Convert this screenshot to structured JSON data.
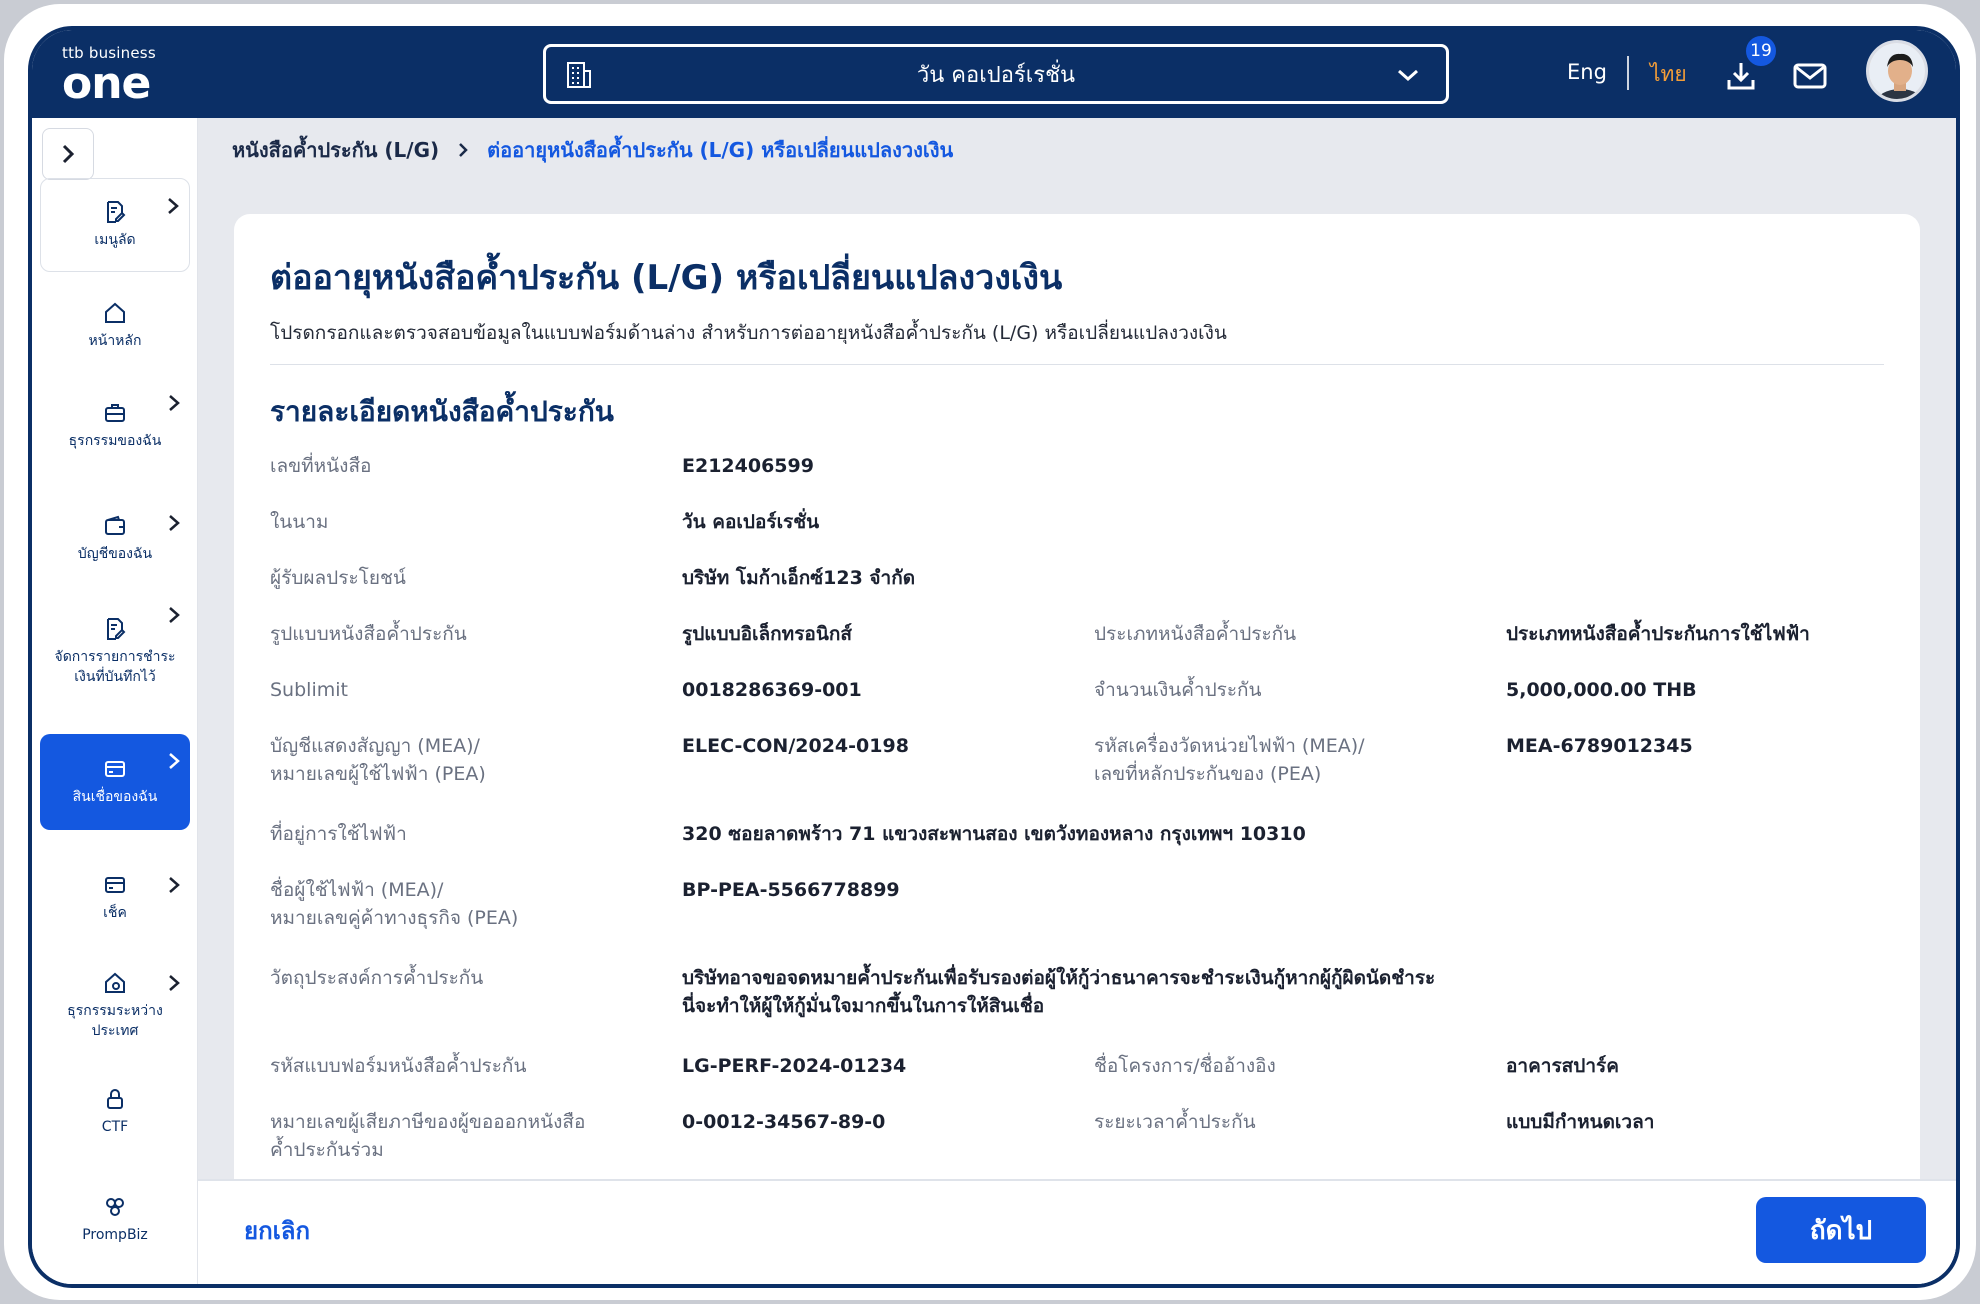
{
  "header": {
    "logo_small": "ttb business",
    "logo_big": "one",
    "company": "วัน คอเปอร์เรชั่น",
    "lang_eng": "Eng",
    "lang_th": "ไทย",
    "download_badge": "19",
    "icons": [
      "building-icon",
      "chevron-down-icon",
      "download-icon",
      "mail-icon"
    ]
  },
  "sidebar": {
    "items": [
      {
        "label": "เมนูลัด"
      },
      {
        "label": "หน้าหลัก"
      },
      {
        "label": "ธุรกรรมของฉัน"
      },
      {
        "label": "บัญชีของฉัน"
      },
      {
        "label": "จัดการรายการชำระเงินที่บันทึกไว้"
      },
      {
        "label": "สินเชื่อของฉัน"
      },
      {
        "label": "เช็ค"
      },
      {
        "label": "ธุรกรรมระหว่างประเทศ"
      },
      {
        "label": "CTF"
      },
      {
        "label": "PrompBiz"
      }
    ]
  },
  "breadcrumb": {
    "parent": "หนังสือค้ำประกัน (L/G)",
    "current": "ต่ออายุหนังสือค้ำประกัน (L/G) หรือเปลี่ยนแปลงวงเงิน"
  },
  "page": {
    "title": "ต่ออายุหนังสือค้ำประกัน (L/G) หรือเปลี่ยนแปลงวงเงิน",
    "subtitle": "โปรดกรอกและตรวจสอบข้อมูลในแบบฟอร์มด้านล่าง สำหรับการต่ออายุหนังสือค้ำประกัน (L/G) หรือเปลี่ยนแปลงวงเงิน",
    "section_title": "รายละเอียดหนังสือค้ำประกัน"
  },
  "details": {
    "doc_no_label": "เลขที่หนังสือ",
    "doc_no": "E212406599",
    "on_behalf_label": "ในนาม",
    "on_behalf": "วัน คอเปอร์เรชั่น",
    "beneficiary_label": "ผู้รับผลประโยชน์",
    "beneficiary": "บริษัท โมก้าเอ็กซ์123 จำกัด",
    "format_label": "รูปแบบหนังสือค้ำประกัน",
    "format": "รูปแบบอิเล็กทรอนิกส์",
    "type_label": "ประเภทหนังสือค้ำประกัน",
    "type": "ประเภทหนังสือค้ำประกันการใช้ไฟฟ้า",
    "sublimit_label": "Sublimit",
    "sublimit": "0018286369-001",
    "amount_label": "จำนวนเงินค้ำประกัน",
    "amount": "5,000,000.00 THB",
    "contract_label_1": "บัญชีแสดงสัญญา (MEA)/",
    "contract_label_2": "หมายเลขผู้ใช้ไฟฟ้า (PEA)",
    "contract": "ELEC-CON/2024-0198",
    "meter_label_1": "รหัสเครื่องวัดหน่วยไฟฟ้า (MEA)/",
    "meter_label_2": "เลขที่หลักประกันของ (PEA)",
    "meter": "MEA-6789012345",
    "address_label": "ที่อยู่การใช้ไฟฟ้า",
    "address": "320 ซอยลาดพร้าว 71 แขวงสะพานสอง เขตวังทองหลาง กรุงเทพฯ 10310",
    "user_label_1": "ชื่อผู้ใช้ไฟฟ้า (MEA)/",
    "user_label_2": "หมายเลขคู่ค้าทางธุรกิจ (PEA)",
    "user": "BP-PEA-5566778899",
    "purpose_label": "วัตถุประสงค์การค้ำประกัน",
    "purpose_1": "บริษัทอาจขอจดหมายค้ำประกันเพื่อรับรองต่อผู้ให้กู้ว่าธนาคารจะชำระเงินกู้หากผู้กู้ผิดนัดชำระ",
    "purpose_2": "นี่จะทำให้ผู้ให้กู้มั่นใจมากขึ้นในการให้สินเชื่อ",
    "form_code_label": "รหัสแบบฟอร์มหนังสือค้ำประกัน",
    "form_code": "LG-PERF-2024-01234",
    "project_label": "ชื่อโครงการ/ชื่ออ้างอิง",
    "project": "อาคารสปาร์ค",
    "tax_label_1": "หมายเลขผู้เสียภาษีของผู้ขอออกหนังสือ",
    "tax_label_2": "ค้ำประกันร่วม",
    "tax": "0-0012-34567-89-0",
    "period_label": "ระยะเวลาค้ำประกัน",
    "period": "แบบมีกำหนดเวลา"
  },
  "footer": {
    "cancel": "ยกเลิก",
    "next": "ถัดไป"
  }
}
